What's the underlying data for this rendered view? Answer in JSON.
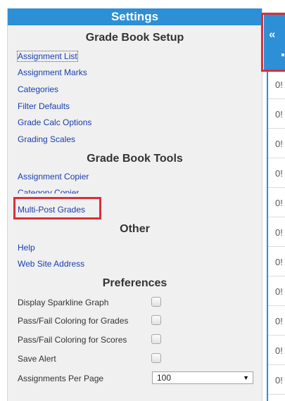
{
  "settings": {
    "title": "Settings",
    "setup": {
      "heading": "Grade Book Setup",
      "links": [
        "Assignment List",
        "Assignment Marks",
        "Categories",
        "Filter Defaults",
        "Grade Calc Options",
        "Grading Scales"
      ]
    },
    "tools": {
      "heading": "Grade Book Tools",
      "links": [
        "Assignment Copier",
        "Category Copier",
        "Multi-Post Grades"
      ]
    },
    "other": {
      "heading": "Other",
      "links": [
        "Help",
        "Web Site Address"
      ]
    },
    "preferences": {
      "heading": "Preferences",
      "items": [
        "Display Sparkline Graph",
        "Pass/Fail Coloring for Grades",
        "Pass/Fail Coloring for Scores",
        "Save Alert"
      ],
      "per_page": {
        "label": "Assignments Per Page",
        "value": "100"
      }
    }
  },
  "grid": {
    "collapse_icon": "double-chevron-left-icon",
    "cell_values": [
      "0!",
      "0!",
      "0!",
      "0!",
      "0!",
      "0!",
      "0!",
      "0!",
      "0!",
      "0!",
      "0!"
    ]
  },
  "colors": {
    "header_blue": "#2d8fd5",
    "link_blue": "#1a3db0",
    "highlight_red": "#d7303a"
  }
}
